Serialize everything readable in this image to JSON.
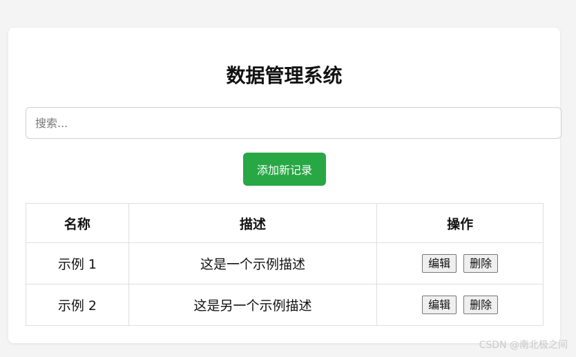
{
  "page": {
    "title": "数据管理系统"
  },
  "search": {
    "placeholder": "搜索...",
    "value": ""
  },
  "toolbar": {
    "add_label": "添加新记录"
  },
  "table": {
    "headers": [
      "名称",
      "描述",
      "操作"
    ],
    "rows": [
      {
        "name": "示例 1",
        "description": "这是一个示例描述",
        "edit_label": "编辑",
        "delete_label": "删除"
      },
      {
        "name": "示例 2",
        "description": "这是另一个示例描述",
        "edit_label": "编辑",
        "delete_label": "删除"
      }
    ]
  },
  "colors": {
    "primary_button": "#28a745",
    "background": "#f4f4f4",
    "card": "#ffffff"
  },
  "watermark": {
    "text": "CSDN @南北极之间"
  }
}
